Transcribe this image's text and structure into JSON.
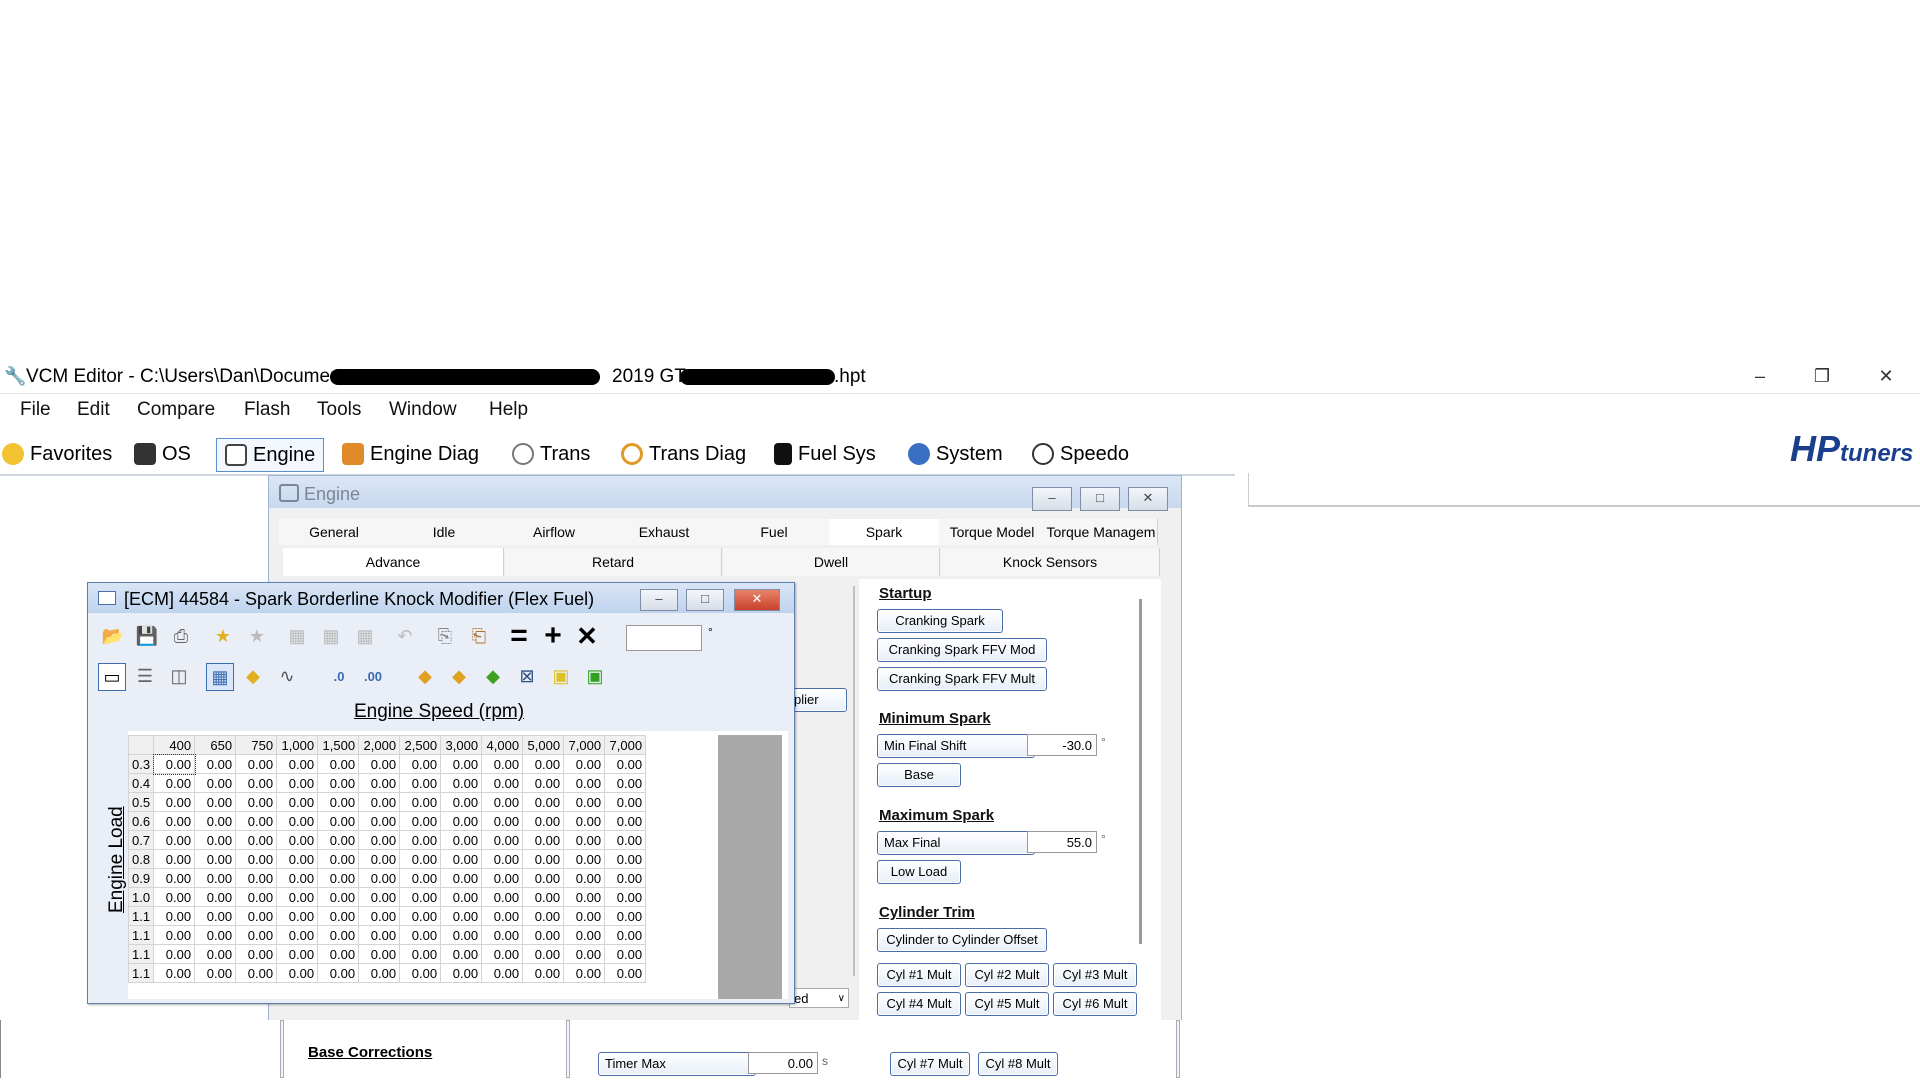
{
  "app": {
    "title": "VCM Editor - C:\\Users\\Dan\\Documents",
    "title_mid": "2019 GT",
    "title_end": ".hpt",
    "logo_main": "HP",
    "logo_sub": "tuners"
  },
  "menu": [
    "File",
    "Edit",
    "Compare",
    "Flash",
    "Tools",
    "Window",
    "Help"
  ],
  "main_tabs": [
    {
      "label": "Favorites",
      "icon": "star-icon"
    },
    {
      "label": "OS",
      "icon": "chip-icon"
    },
    {
      "label": "Engine",
      "icon": "engine-icon"
    },
    {
      "label": "Engine Diag",
      "icon": "engine-diag-icon"
    },
    {
      "label": "Trans",
      "icon": "gear-icon"
    },
    {
      "label": "Trans Diag",
      "icon": "gear-diag-icon"
    },
    {
      "label": "Fuel Sys",
      "icon": "fuel-pump-icon"
    },
    {
      "label": "System",
      "icon": "system-icon"
    },
    {
      "label": "Speedo",
      "icon": "speedometer-icon"
    }
  ],
  "engine_window": {
    "title": "Engine",
    "categories": [
      "General",
      "Idle",
      "Airflow",
      "Exhaust",
      "Fuel",
      "Spark",
      "Torque Model",
      "Torque Managem"
    ],
    "subtabs": [
      "Advance",
      "Retard",
      "Dwell",
      "Knock Sensors"
    ],
    "partial_button": "plier",
    "partial_dropdown": "ed",
    "base_corrections": "Base Corrections",
    "timer_max_label": "Timer Max",
    "timer_max_value": "0.00",
    "timer_max_unit": "s"
  },
  "spark_panel": {
    "startup_title": "Startup",
    "startup_buttons": [
      "Cranking Spark",
      "Cranking Spark FFV Mod",
      "Cranking Spark FFV Mult"
    ],
    "min_title": "Minimum Spark",
    "min_final_shift_label": "Min Final Shift",
    "min_final_shift_value": "-30.0",
    "min_base": "Base",
    "max_title": "Maximum Spark",
    "max_final_label": "Max Final",
    "max_final_value": "55.0",
    "max_low_load": "Low Load",
    "cyl_title": "Cylinder Trim",
    "cyl_offset": "Cylinder to Cylinder Offset",
    "cyl_mults": [
      "Cyl #1 Mult",
      "Cyl #2 Mult",
      "Cyl #3 Mult",
      "Cyl #4 Mult",
      "Cyl #5 Mult",
      "Cyl #6 Mult"
    ],
    "cyl_mults_lower": [
      "Cyl #7 Mult",
      "Cyl #8 Mult"
    ],
    "degree_unit": "°"
  },
  "table_window": {
    "title": "[ECM] 44584 - Spark Borderline Knock Modifier (Flex Fuel)",
    "x_axis_label": "Engine Speed (rpm)",
    "y_axis_label": "Engine Load",
    "degree_unit": "°",
    "col_headers": [
      "400",
      "650",
      "750",
      "1,000",
      "1,500",
      "2,000",
      "2,500",
      "3,000",
      "4,000",
      "5,000",
      "7,000",
      "7,000"
    ],
    "row_headers": [
      "0.3",
      "0.4",
      "0.5",
      "0.6",
      "0.7",
      "0.8",
      "0.9",
      "1.0",
      "1.1",
      "1.1",
      "1.1",
      "1.1"
    ],
    "cell_value": "0.00"
  }
}
